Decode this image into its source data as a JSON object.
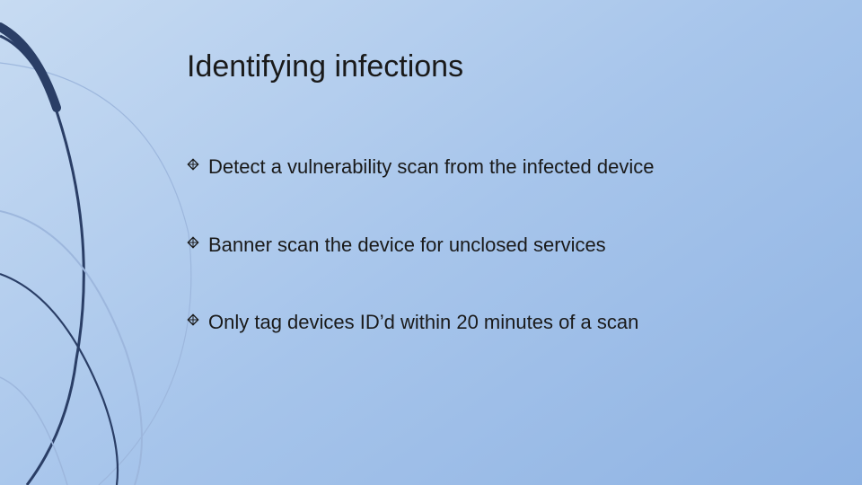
{
  "slide": {
    "title": "Identifying infections",
    "bullets": [
      "Detect a vulnerability scan from the infected device",
      "Banner scan the device for unclosed services",
      "Only tag devices ID’d within 20 minutes of a scan"
    ]
  },
  "colors": {
    "accent_dark": "#2a3e66",
    "accent_light": "#7a9bd0"
  }
}
